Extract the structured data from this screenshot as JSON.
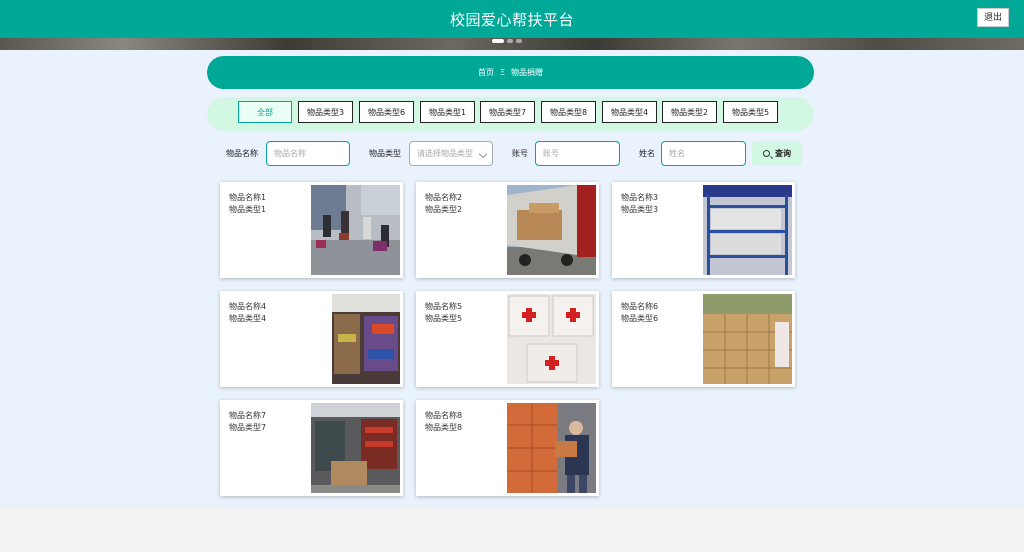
{
  "header": {
    "title": "校园爱心帮扶平台",
    "logout_label": "退出"
  },
  "breadcrumb": {
    "home": "首页",
    "separator": "Ξ",
    "current": "物品捐赠"
  },
  "categories": [
    {
      "label": "全部",
      "active": true
    },
    {
      "label": "物品类型3"
    },
    {
      "label": "物品类型6"
    },
    {
      "label": "物品类型1"
    },
    {
      "label": "物品类型7"
    },
    {
      "label": "物品类型8"
    },
    {
      "label": "物品类型4"
    },
    {
      "label": "物品类型2"
    },
    {
      "label": "物品类型5"
    }
  ],
  "search": {
    "name_label": "物品名称",
    "name_placeholder": "物品名称",
    "type_label": "物品类型",
    "type_placeholder": "请选择物品类型",
    "account_label": "账号",
    "account_placeholder": "账号",
    "person_label": "姓名",
    "person_placeholder": "姓名",
    "button_label": "查询"
  },
  "items": [
    {
      "name": "物品名称1",
      "type": "物品类型1",
      "image": "people-carrying-boxes-photo"
    },
    {
      "name": "物品名称2",
      "type": "物品类型2",
      "image": "truck-loading-photo"
    },
    {
      "name": "物品名称3",
      "type": "物品类型3",
      "image": "shelf-supplies-photo"
    },
    {
      "name": "物品名称4",
      "type": "物品类型4",
      "image": "store-shelves-photo"
    },
    {
      "name": "物品名称5",
      "type": "物品类型5",
      "image": "red-cross-boxes-photo"
    },
    {
      "name": "物品名称6",
      "type": "物品类型6",
      "image": "stacked-cartons-photo"
    },
    {
      "name": "物品名称7",
      "type": "物品类型7",
      "image": "warehouse-store-photo"
    },
    {
      "name": "物品名称8",
      "type": "物品类型8",
      "image": "worker-moving-boxes-photo"
    }
  ],
  "colors": {
    "primary": "#00a898",
    "light_green": "#d2f8e3",
    "page_bg": "#eaf3fd"
  }
}
